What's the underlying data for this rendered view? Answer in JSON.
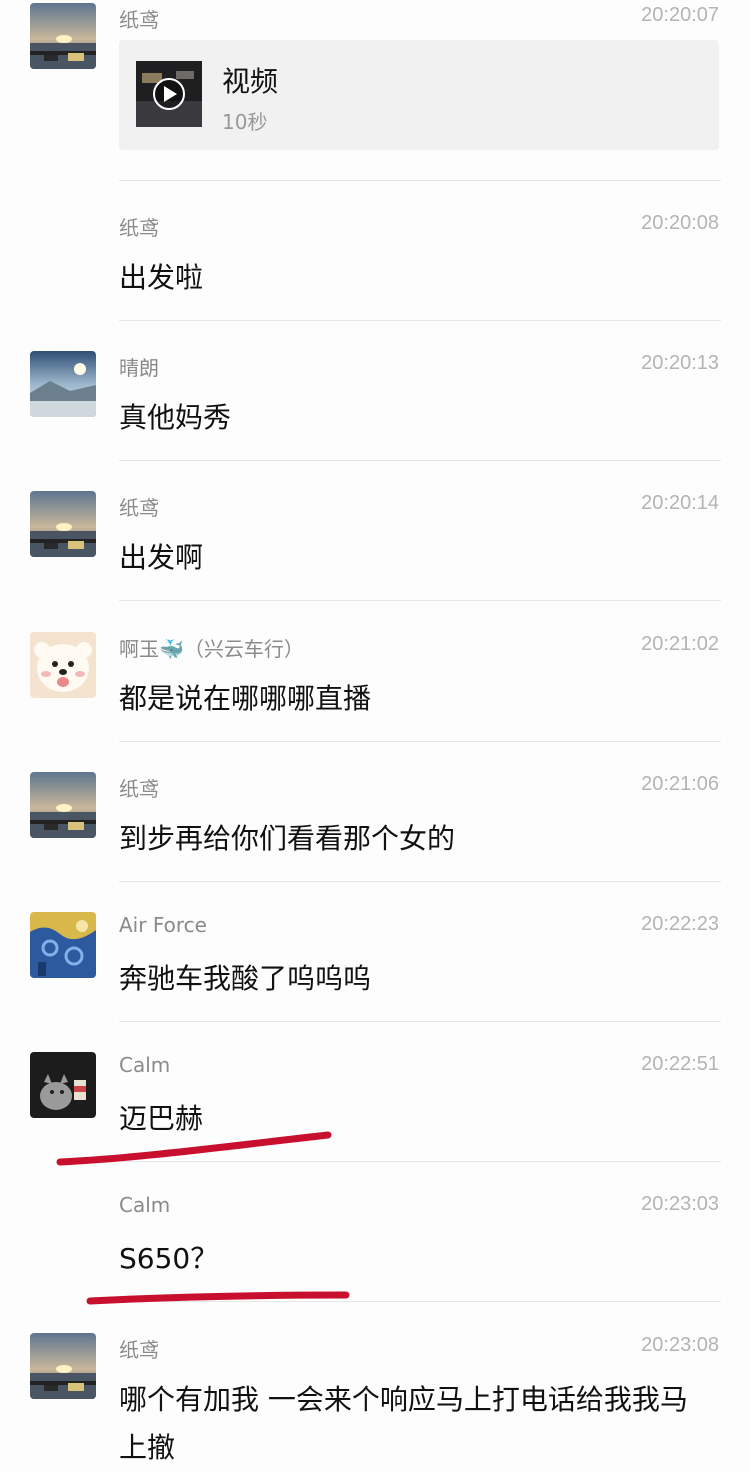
{
  "messages": [
    {
      "sender": "纸鸢",
      "time": "20:20:07",
      "avatar": "sunset-avatar",
      "video": {
        "title": "视频",
        "duration": "10秒"
      }
    },
    {
      "sender": "纸鸢",
      "time": "20:20:08",
      "text": "出发啦"
    },
    {
      "sender": "晴朗",
      "time": "20:20:13",
      "avatar": "lake-avatar",
      "text": "真他妈秀"
    },
    {
      "sender": "纸鸢",
      "time": "20:20:14",
      "avatar": "sunset-avatar",
      "text": "出发啊"
    },
    {
      "sender": "啊玉",
      "sender_suffix": "（兴云车行）",
      "time": "20:21:02",
      "avatar": "puppy-avatar",
      "text": "都是说在哪哪哪直播"
    },
    {
      "sender": "纸鸢",
      "time": "20:21:06",
      "avatar": "sunset-avatar",
      "text": "到步再给你们看看那个女的"
    },
    {
      "sender": "Air Force",
      "time": "20:22:23",
      "avatar": "starry-night-avatar",
      "text": "奔驰车我酸了呜呜呜"
    },
    {
      "sender": "Calm",
      "time": "20:22:51",
      "avatar": "cat-avatar",
      "text": "迈巴赫"
    },
    {
      "sender": "Calm",
      "time": "20:23:03",
      "text": "S650？"
    },
    {
      "sender": "纸鸢",
      "time": "20:23:08",
      "avatar": "sunset-avatar",
      "text": "哪个有加我 一会来个响应马上打电话给我我马上撤"
    }
  ],
  "annotation_color": "#c8102e"
}
